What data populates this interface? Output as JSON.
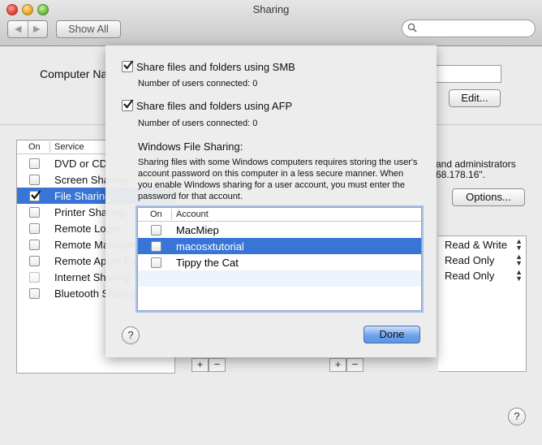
{
  "window": {
    "title": "Sharing",
    "show_all_label": "Show All",
    "search_placeholder": ""
  },
  "main": {
    "computer_name_label": "Computer Na",
    "edit_label": "Edit...",
    "options_label": "Options...",
    "service_list": {
      "col_on": "On",
      "col_service": "Service",
      "items": [
        {
          "label": "DVD or CD",
          "on": false
        },
        {
          "label": "Screen Sharing",
          "on": false
        },
        {
          "label": "File Sharing",
          "on": true
        },
        {
          "label": "Printer Sharing",
          "on": false
        },
        {
          "label": "Remote Login",
          "on": false
        },
        {
          "label": "Remote Management",
          "on": false
        },
        {
          "label": "Remote Apple Events",
          "on": false
        },
        {
          "label": "Internet Sharing",
          "on": false
        },
        {
          "label": "Bluetooth Sharing",
          "on": false
        }
      ]
    },
    "admins_text_line1": "and administrators",
    "admins_text_line2": "68.178.16\".",
    "permissions": [
      "Read & Write",
      "Read Only",
      "Read Only"
    ]
  },
  "sheet": {
    "smb_label": "Share files and folders using SMB",
    "smb_checked": true,
    "smb_users": "Number of users connected: 0",
    "afp_label": "Share files and folders using AFP",
    "afp_checked": true,
    "afp_users": "Number of users connected: 0",
    "wfs_title": "Windows File Sharing:",
    "wfs_description": "Sharing files with some Windows computers requires storing the user's account password on this computer in a less secure manner.  When you enable Windows sharing for a user account, you must enter the password for that account.",
    "accounts_table": {
      "col_on": "On",
      "col_account": "Account",
      "rows": [
        {
          "name": "MacMiep",
          "on": false
        },
        {
          "name": "macosxtutorial",
          "on": false
        },
        {
          "name": "Tippy the Cat",
          "on": false
        }
      ]
    },
    "help_label": "?",
    "done_label": "Done"
  },
  "colors": {
    "selection": "#3875d7",
    "default_button": "#6fa3ec"
  }
}
